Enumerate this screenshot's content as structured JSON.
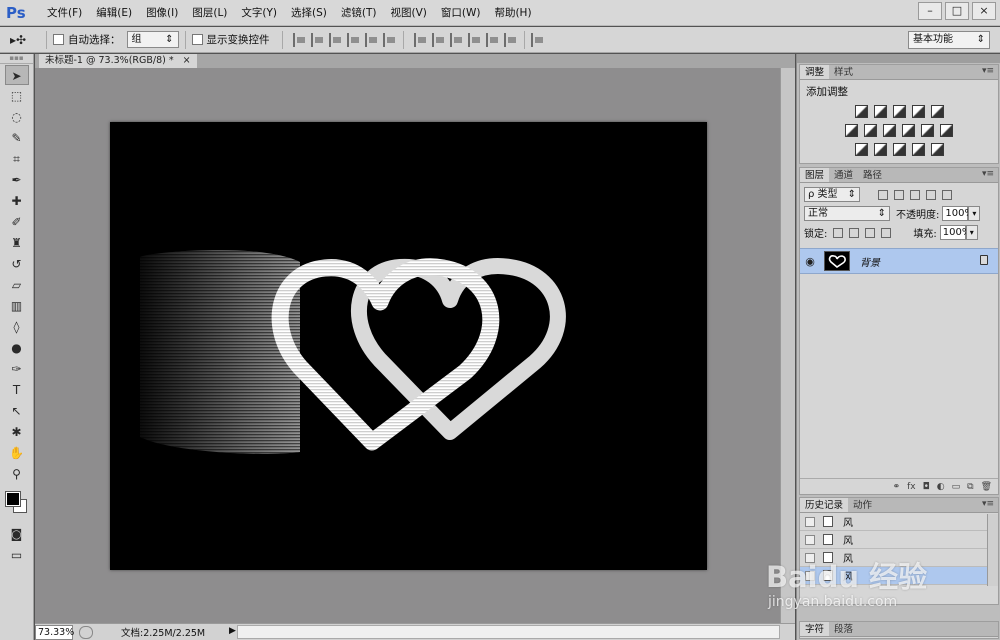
{
  "app": {
    "logo": "Ps",
    "menus": [
      "文件(F)",
      "编辑(E)",
      "图像(I)",
      "图层(L)",
      "文字(Y)",
      "选择(S)",
      "滤镜(T)",
      "视图(V)",
      "窗口(W)",
      "帮助(H)"
    ],
    "window_buttons": [
      "–",
      "□",
      "×"
    ]
  },
  "options_bar": {
    "tool_glyph": "▸✣",
    "auto_select_label": "自动选择：",
    "auto_select_value": "组",
    "show_transform_label": "显示变换控件",
    "workspace": "基本功能"
  },
  "document": {
    "tab_title": "未标题-1 @ 73.3%(RGB/8) *",
    "tab_close": "×",
    "zoom": "73.33%",
    "doc_size": "文档:2.25M/2.25M",
    "canvas_bg": "#000000"
  },
  "adjustments_panel": {
    "tabs": [
      "调整",
      "样式"
    ],
    "title": "添加调整"
  },
  "layers_panel": {
    "tabs": [
      "图层",
      "通道",
      "路径"
    ],
    "filter_label": "ρ 类型",
    "blend_mode": "正常",
    "opacity_label": "不透明度:",
    "opacity_value": "100%",
    "lock_label": "锁定:",
    "fill_label": "填充:",
    "fill_value": "100%",
    "layers": [
      {
        "name": "背景",
        "visible": true,
        "locked": true
      }
    ]
  },
  "history_panel": {
    "tabs": [
      "历史记录",
      "动作"
    ],
    "items": [
      {
        "label": "风",
        "selected": false
      },
      {
        "label": "风",
        "selected": false
      },
      {
        "label": "风",
        "selected": false
      },
      {
        "label": "风",
        "selected": true
      }
    ]
  },
  "bottom_panel": {
    "tabs": [
      "字符",
      "段落"
    ]
  },
  "watermark": {
    "brand": "Baidu 经验",
    "url": "jingyan.baidu.com"
  }
}
